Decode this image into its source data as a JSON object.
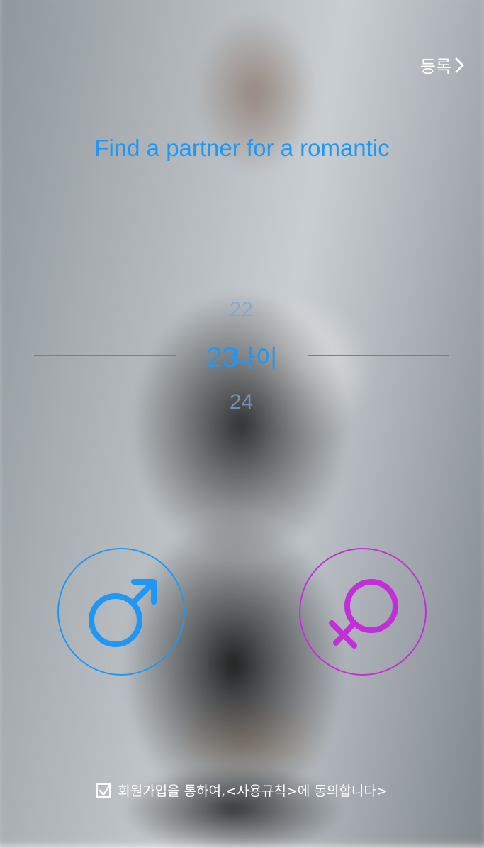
{
  "header": {
    "register_label": "등록"
  },
  "title": "Find a partner for a romantic",
  "age_picker": {
    "previous": "22",
    "current": "23",
    "unit": "나이",
    "next": "24"
  },
  "gender": {
    "male_icon": "male-symbol",
    "female_icon": "female-symbol",
    "male_color": "#1f97f5",
    "female_color": "#c32ed9"
  },
  "agreement": {
    "checked": true,
    "text": "회원가입을 통하여,<사용규칙>에 동의합니다>"
  }
}
